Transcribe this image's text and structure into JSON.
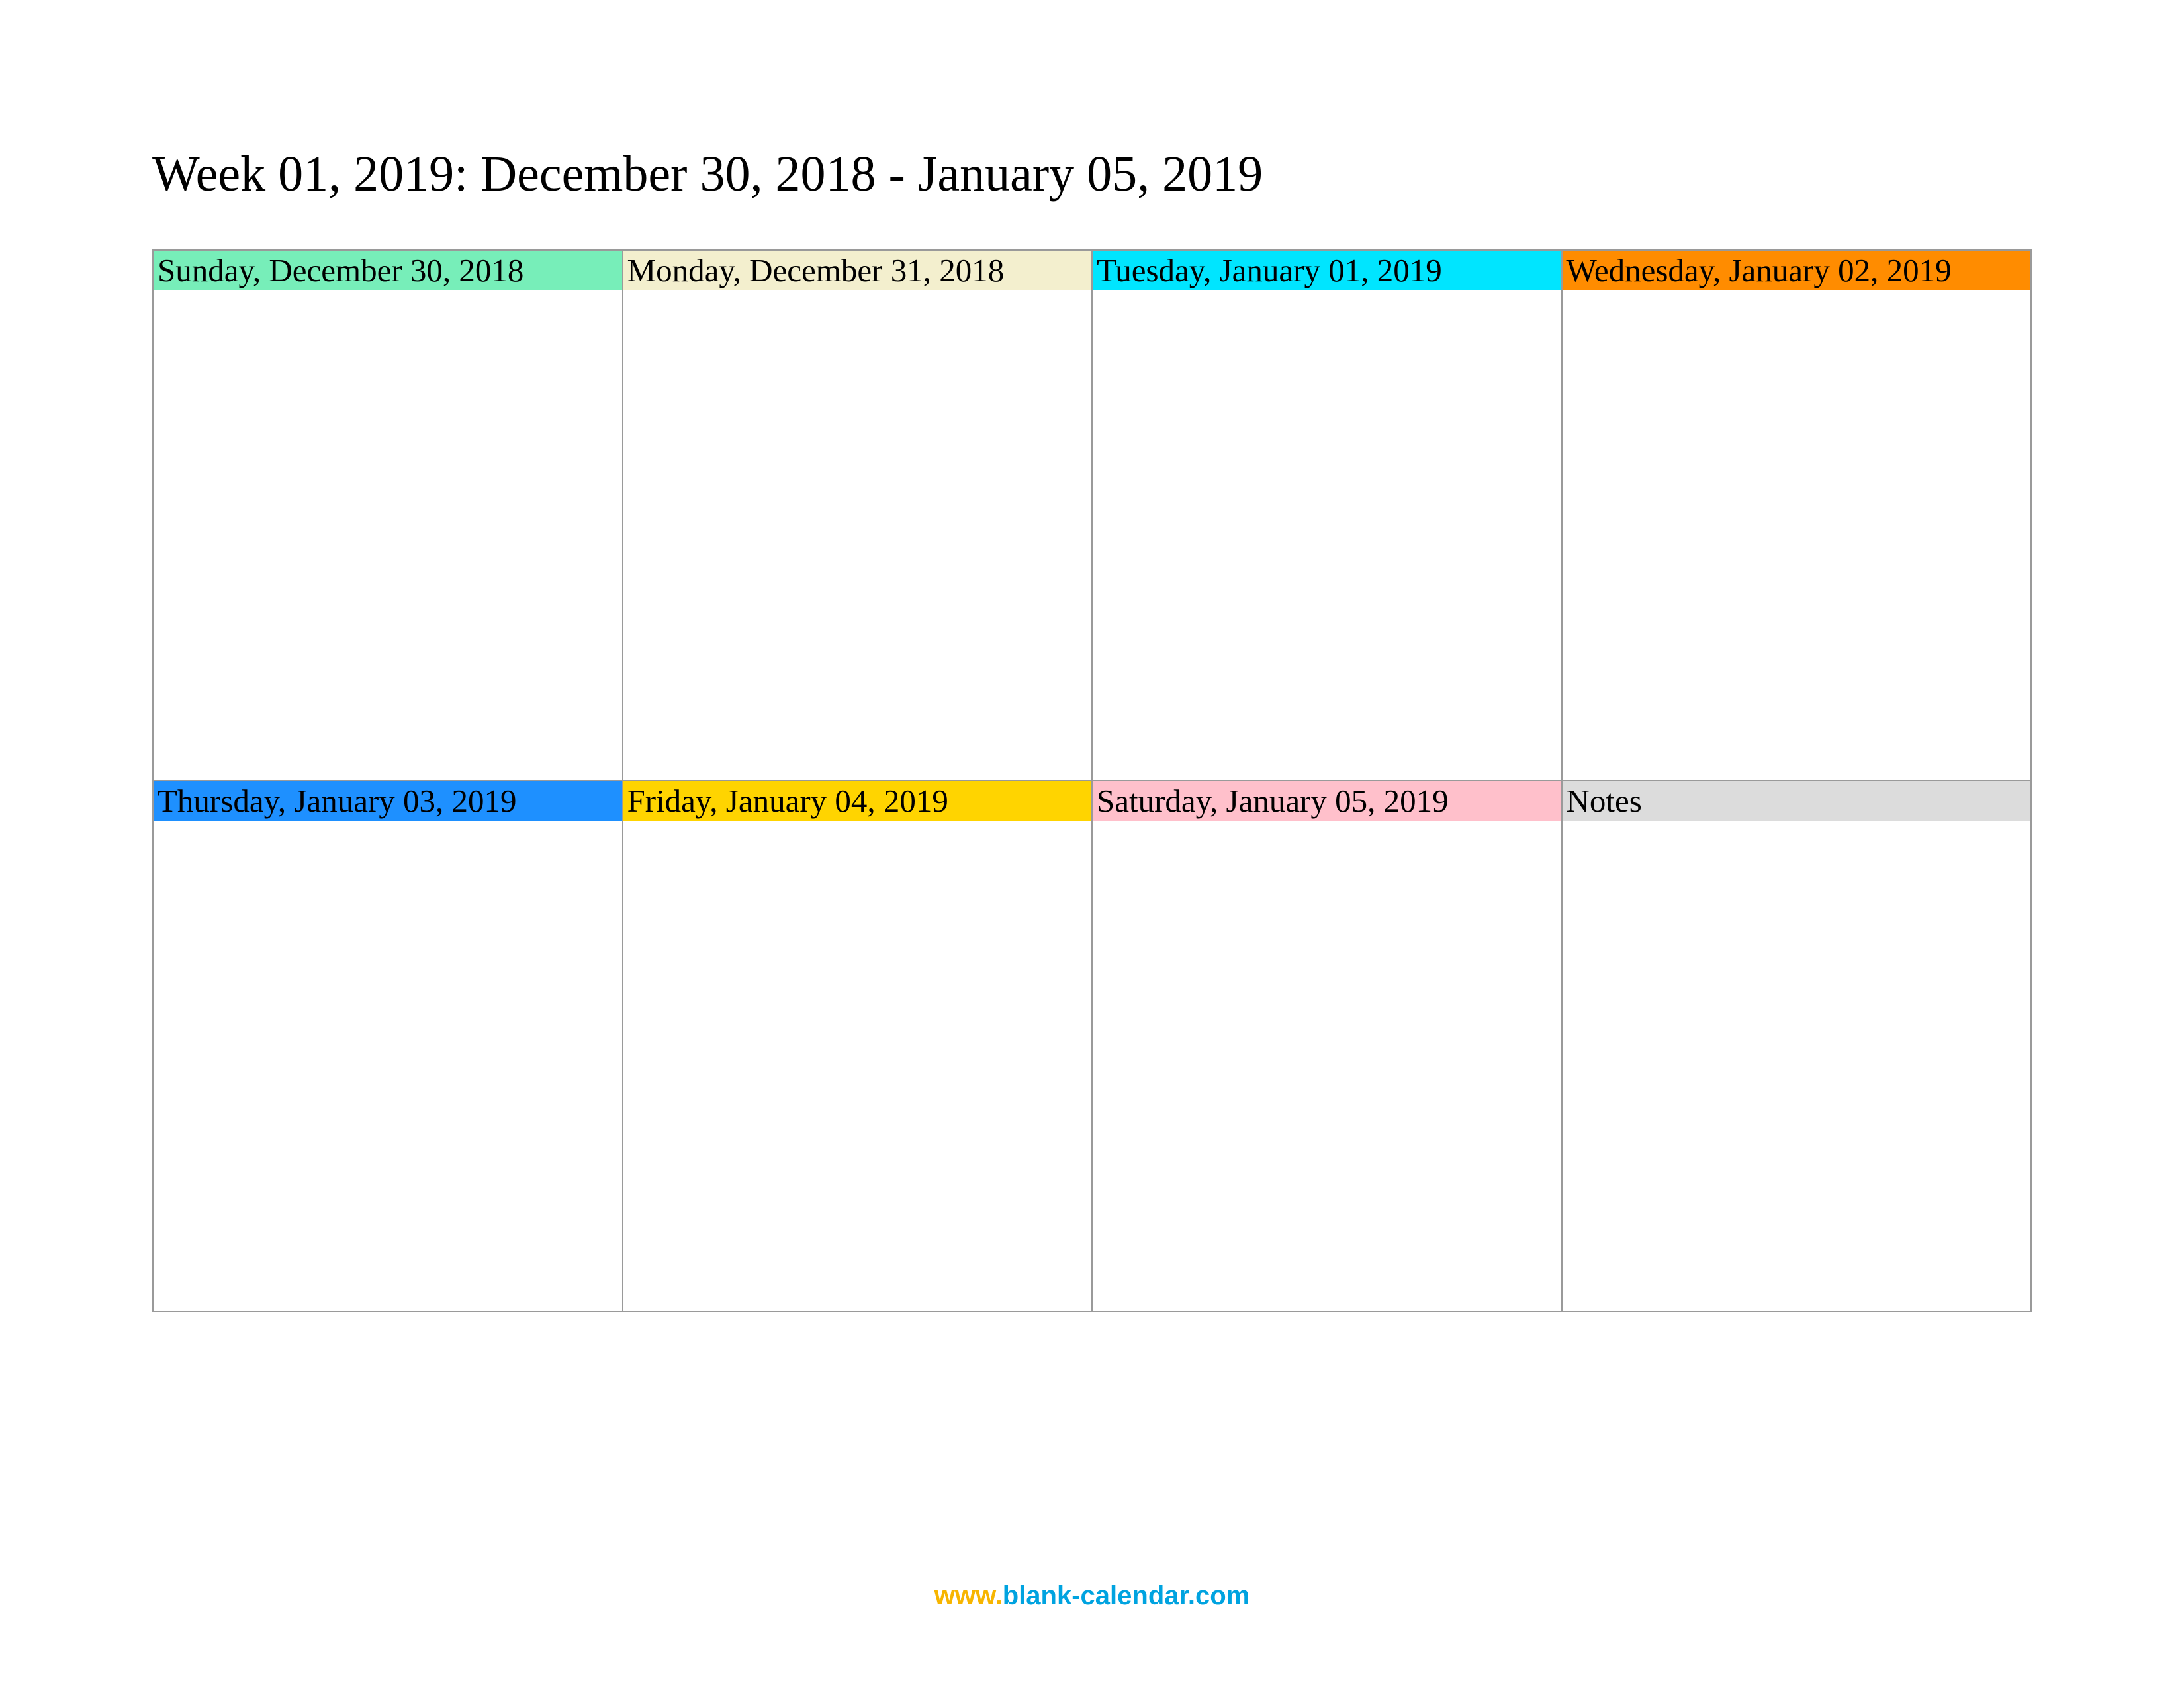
{
  "title": "Week 01, 2019: December 30, 2018 - January 05, 2019",
  "cells": [
    {
      "label": "Sunday, December 30, 2018",
      "bg": "#77eeb9"
    },
    {
      "label": "Monday, December 31, 2018",
      "bg": "#f3efce"
    },
    {
      "label": "Tuesday, January 01, 2019",
      "bg": "#00e5ff"
    },
    {
      "label": "Wednesday, January 02, 2019",
      "bg": "#ff8c00"
    },
    {
      "label": "Thursday, January 03, 2019",
      "bg": "#1e90ff"
    },
    {
      "label": "Friday, January 04, 2019",
      "bg": "#ffd400"
    },
    {
      "label": "Saturday, January 05, 2019",
      "bg": "#ffc0cb"
    },
    {
      "label": "Notes",
      "bg": "#dcdcdc"
    }
  ],
  "footer": {
    "prefix": "www.",
    "domain": "blank-calendar.com"
  }
}
